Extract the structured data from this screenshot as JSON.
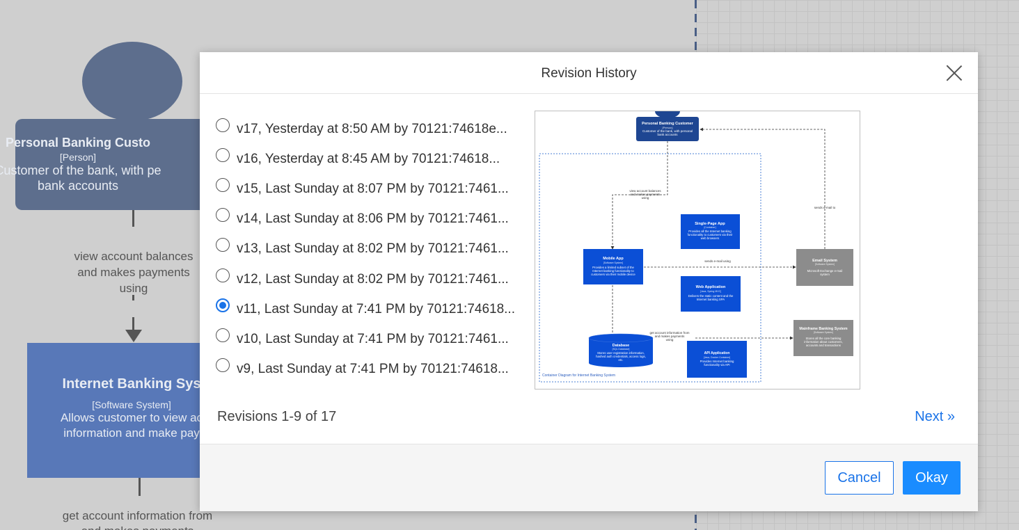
{
  "background": {
    "person": {
      "name": "Personal Banking Custo",
      "type": "[Person]",
      "desc_line1": "Customer of the bank, with pe",
      "desc_line2": "bank accounts"
    },
    "edge_label1": [
      "view account balances",
      "and makes payments",
      "using"
    ],
    "system": {
      "name": "Internet Banking Sys",
      "type": "[Software System]",
      "desc_line1": "Allows customer to view ac",
      "desc_line2": "information and make pay"
    },
    "edge_label2": [
      "get account information from",
      "and makes payments"
    ]
  },
  "modal": {
    "title": "Revision History",
    "revisions": [
      {
        "label": "v17, Yesterday at 8:50 AM by 70121:74618e...",
        "checked": false
      },
      {
        "label": "v16, Yesterday at 8:45 AM by 70121:74618...",
        "checked": false
      },
      {
        "label": "v15, Last Sunday at 8:07 PM by 70121:7461...",
        "checked": false
      },
      {
        "label": "v14, Last Sunday at 8:06 PM by 70121:7461...",
        "checked": false
      },
      {
        "label": "v13, Last Sunday at 8:02 PM by 70121:7461...",
        "checked": false
      },
      {
        "label": "v12, Last Sunday at 8:02 PM by 70121:7461...",
        "checked": false
      },
      {
        "label": "v11, Last Sunday at 7:41 PM by 70121:74618...",
        "checked": true
      },
      {
        "label": "v10, Last Sunday at 7:41 PM by 70121:7461...",
        "checked": false
      },
      {
        "label": "v9, Last Sunday at 7:41 PM by 70121:74618...",
        "checked": false
      }
    ],
    "revision_count": "Revisions 1-9 of 17",
    "next_label": "Next »",
    "cancel_label": "Cancel",
    "okay_label": "Okay",
    "preview": {
      "customer": {
        "name": "Personal Banking Customer",
        "type": "[Person]",
        "desc": [
          "Customer of the bank, with personal",
          "bank accounts"
        ]
      },
      "boundary_label": "Container Diagram for Internet Banking System",
      "spa": {
        "name": "Single-Page App",
        "type": "[Container]",
        "desc": [
          "Provides all the Internet banking",
          "functionality to customers via their",
          "web browsers"
        ]
      },
      "mobile": {
        "name": "Mobile App",
        "type": "[Software System]",
        "desc": [
          "Provides a limited subset of the",
          "Internet banking functionality to",
          "customers via their mobile device"
        ]
      },
      "web": {
        "name": "Web Application",
        "type": "[Java, Spring MVC]",
        "desc": [
          "Delivers the static content and the",
          "Internet banking SPA"
        ]
      },
      "email": {
        "name": "Email System",
        "type": "[Software System]",
        "desc": [
          "Microsoft Exchange e-mail",
          "system"
        ]
      },
      "mainframe": {
        "name": "Mainframe Banking System",
        "type": "[Software System]",
        "desc": [
          "Stores all the core banking",
          "information about customers,",
          "accounts and transactions"
        ]
      },
      "database": {
        "name": "Database",
        "type": "[SQL Database]",
        "desc": [
          "Stores user registration information,",
          "hashed auth credentials, access logs,",
          "etc."
        ]
      },
      "api": {
        "name": "API Application",
        "type": "[Java, Docker Container]",
        "desc": [
          "Provides Internet banking",
          "functionality via API"
        ]
      },
      "edge_view": [
        "view account balances",
        "and makes payments",
        "using"
      ],
      "edge_sends_email": "sends e-mail to",
      "edge_sends_email_using": "sends e-mail using",
      "edge_get_account": [
        "get account information from",
        "and makes payments",
        "using"
      ]
    },
    "colors": {
      "accent": "#1a73e8",
      "okay_bg": "#1a8cff",
      "node_blue": "#0b4fd6",
      "node_dark": "#1e4692",
      "node_gray": "#8c8c8c"
    }
  }
}
